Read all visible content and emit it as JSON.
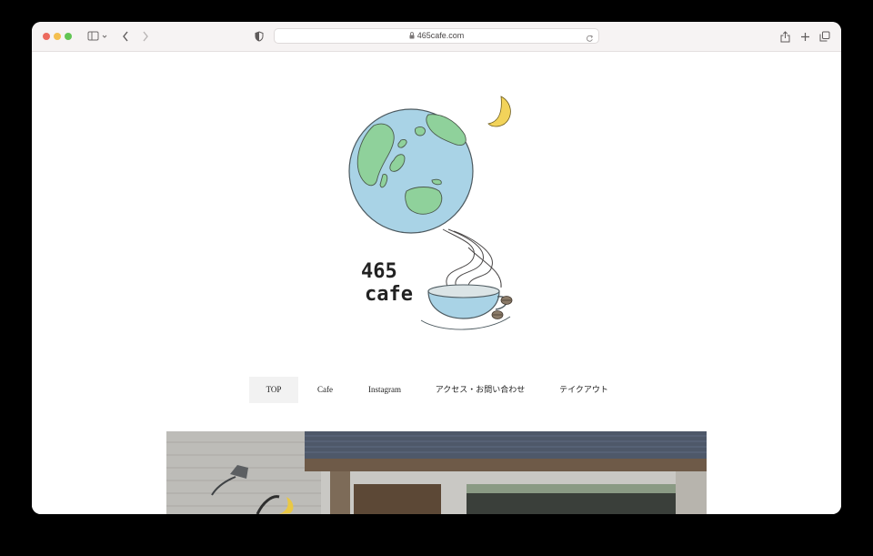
{
  "browser": {
    "url": "465cafe.com"
  },
  "site": {
    "logo_text_line1": "465",
    "logo_text_line2": "cafe"
  },
  "nav": {
    "items": [
      {
        "label": "TOP"
      },
      {
        "label": "Cafe"
      },
      {
        "label": "Instagram"
      },
      {
        "label": "アクセス・お問い合わせ"
      },
      {
        "label": "テイクアウト"
      }
    ]
  },
  "colors": {
    "accent": "#f2f2f2",
    "globe_blue": "#a9d3e6",
    "globe_green": "#8fd19b",
    "moon": "#f2d35a"
  }
}
